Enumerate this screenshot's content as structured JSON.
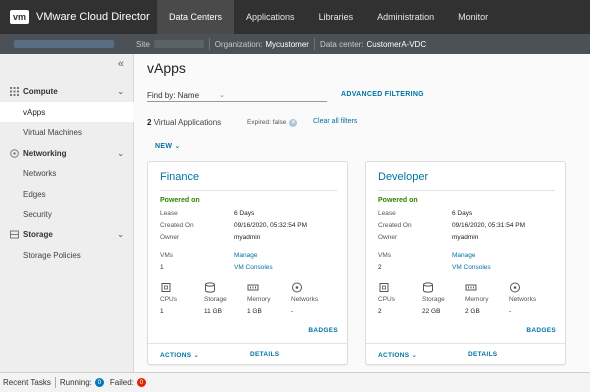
{
  "app": {
    "logo": "vm",
    "title": "VMware Cloud Director"
  },
  "nav": {
    "tabs": [
      {
        "label": "Data Centers",
        "active": true
      },
      {
        "label": "Applications"
      },
      {
        "label": "Libraries"
      },
      {
        "label": "Administration"
      },
      {
        "label": "Monitor"
      }
    ]
  },
  "context": {
    "site_label": "Site",
    "org_label": "Organization:",
    "org_value": "Mycustomer",
    "dc_label": "Data center:",
    "dc_value": "CustomerA-VDC"
  },
  "sidebar": {
    "collapse_glyph": "«",
    "groups": [
      {
        "label": "Compute",
        "icon": "grid-icon",
        "items": [
          "vApps",
          "Virtual Machines"
        ]
      },
      {
        "label": "Networking",
        "icon": "network-icon",
        "items": [
          "Networks",
          "Edges",
          "Security"
        ]
      },
      {
        "label": "Storage",
        "icon": "storage-icon",
        "items": [
          "Storage Policies"
        ]
      }
    ],
    "selected": "vApps"
  },
  "main": {
    "title": "vApps",
    "find_by": "Find by: Name",
    "advanced_filtering": "ADVANCED FILTERING",
    "count_number": "2",
    "count_text": "Virtual Applications",
    "filter_chip": "Expired: false",
    "clear_filters": "Clear all filters",
    "new_button": "NEW ⌄"
  },
  "cards": [
    {
      "name": "Finance",
      "status": "Powered on",
      "lease_label": "Lease",
      "lease": "6 Days",
      "created_label": "Created On",
      "created": "09/16/2020, 05:32:54 PM",
      "owner_label": "Owner",
      "owner": "myadmin",
      "vms_label": "VMs",
      "vms": "1",
      "manage": "Manage",
      "consoles": "VM Consoles",
      "cpus_label": "CPUs",
      "cpus": "1",
      "storage_label": "Storage",
      "storage": "11 GB",
      "memory_label": "Memory",
      "memory": "1 GB",
      "networks_label": "Networks",
      "networks": "-",
      "badges": "BADGES",
      "actions": "ACTIONS ⌄",
      "details": "DETAILS"
    },
    {
      "name": "Developer",
      "status": "Powered on",
      "lease_label": "Lease",
      "lease": "6 Days",
      "created_label": "Created On",
      "created": "09/16/2020, 05:31:54 PM",
      "owner_label": "Owner",
      "owner": "myadmin",
      "vms_label": "VMs",
      "vms": "2",
      "manage": "Manage",
      "consoles": "VM Consoles",
      "cpus_label": "CPUs",
      "cpus": "2",
      "storage_label": "Storage",
      "storage": "22 GB",
      "memory_label": "Memory",
      "memory": "2 GB",
      "networks_label": "Networks",
      "networks": "-",
      "badges": "BADGES",
      "actions": "ACTIONS ⌄",
      "details": "DETAILS"
    }
  ],
  "bottom": {
    "recent_tasks": "Recent Tasks",
    "running_label": "Running:",
    "running_count": "0",
    "running_color": "#0079b8",
    "failed_label": "Failed:",
    "failed_count": "0",
    "failed_color": "#e02200"
  },
  "colors": {
    "nav_bg": "#313131",
    "context_bg": "#4b5157",
    "link": "#0072a3",
    "powered_on": "#2f8400"
  }
}
